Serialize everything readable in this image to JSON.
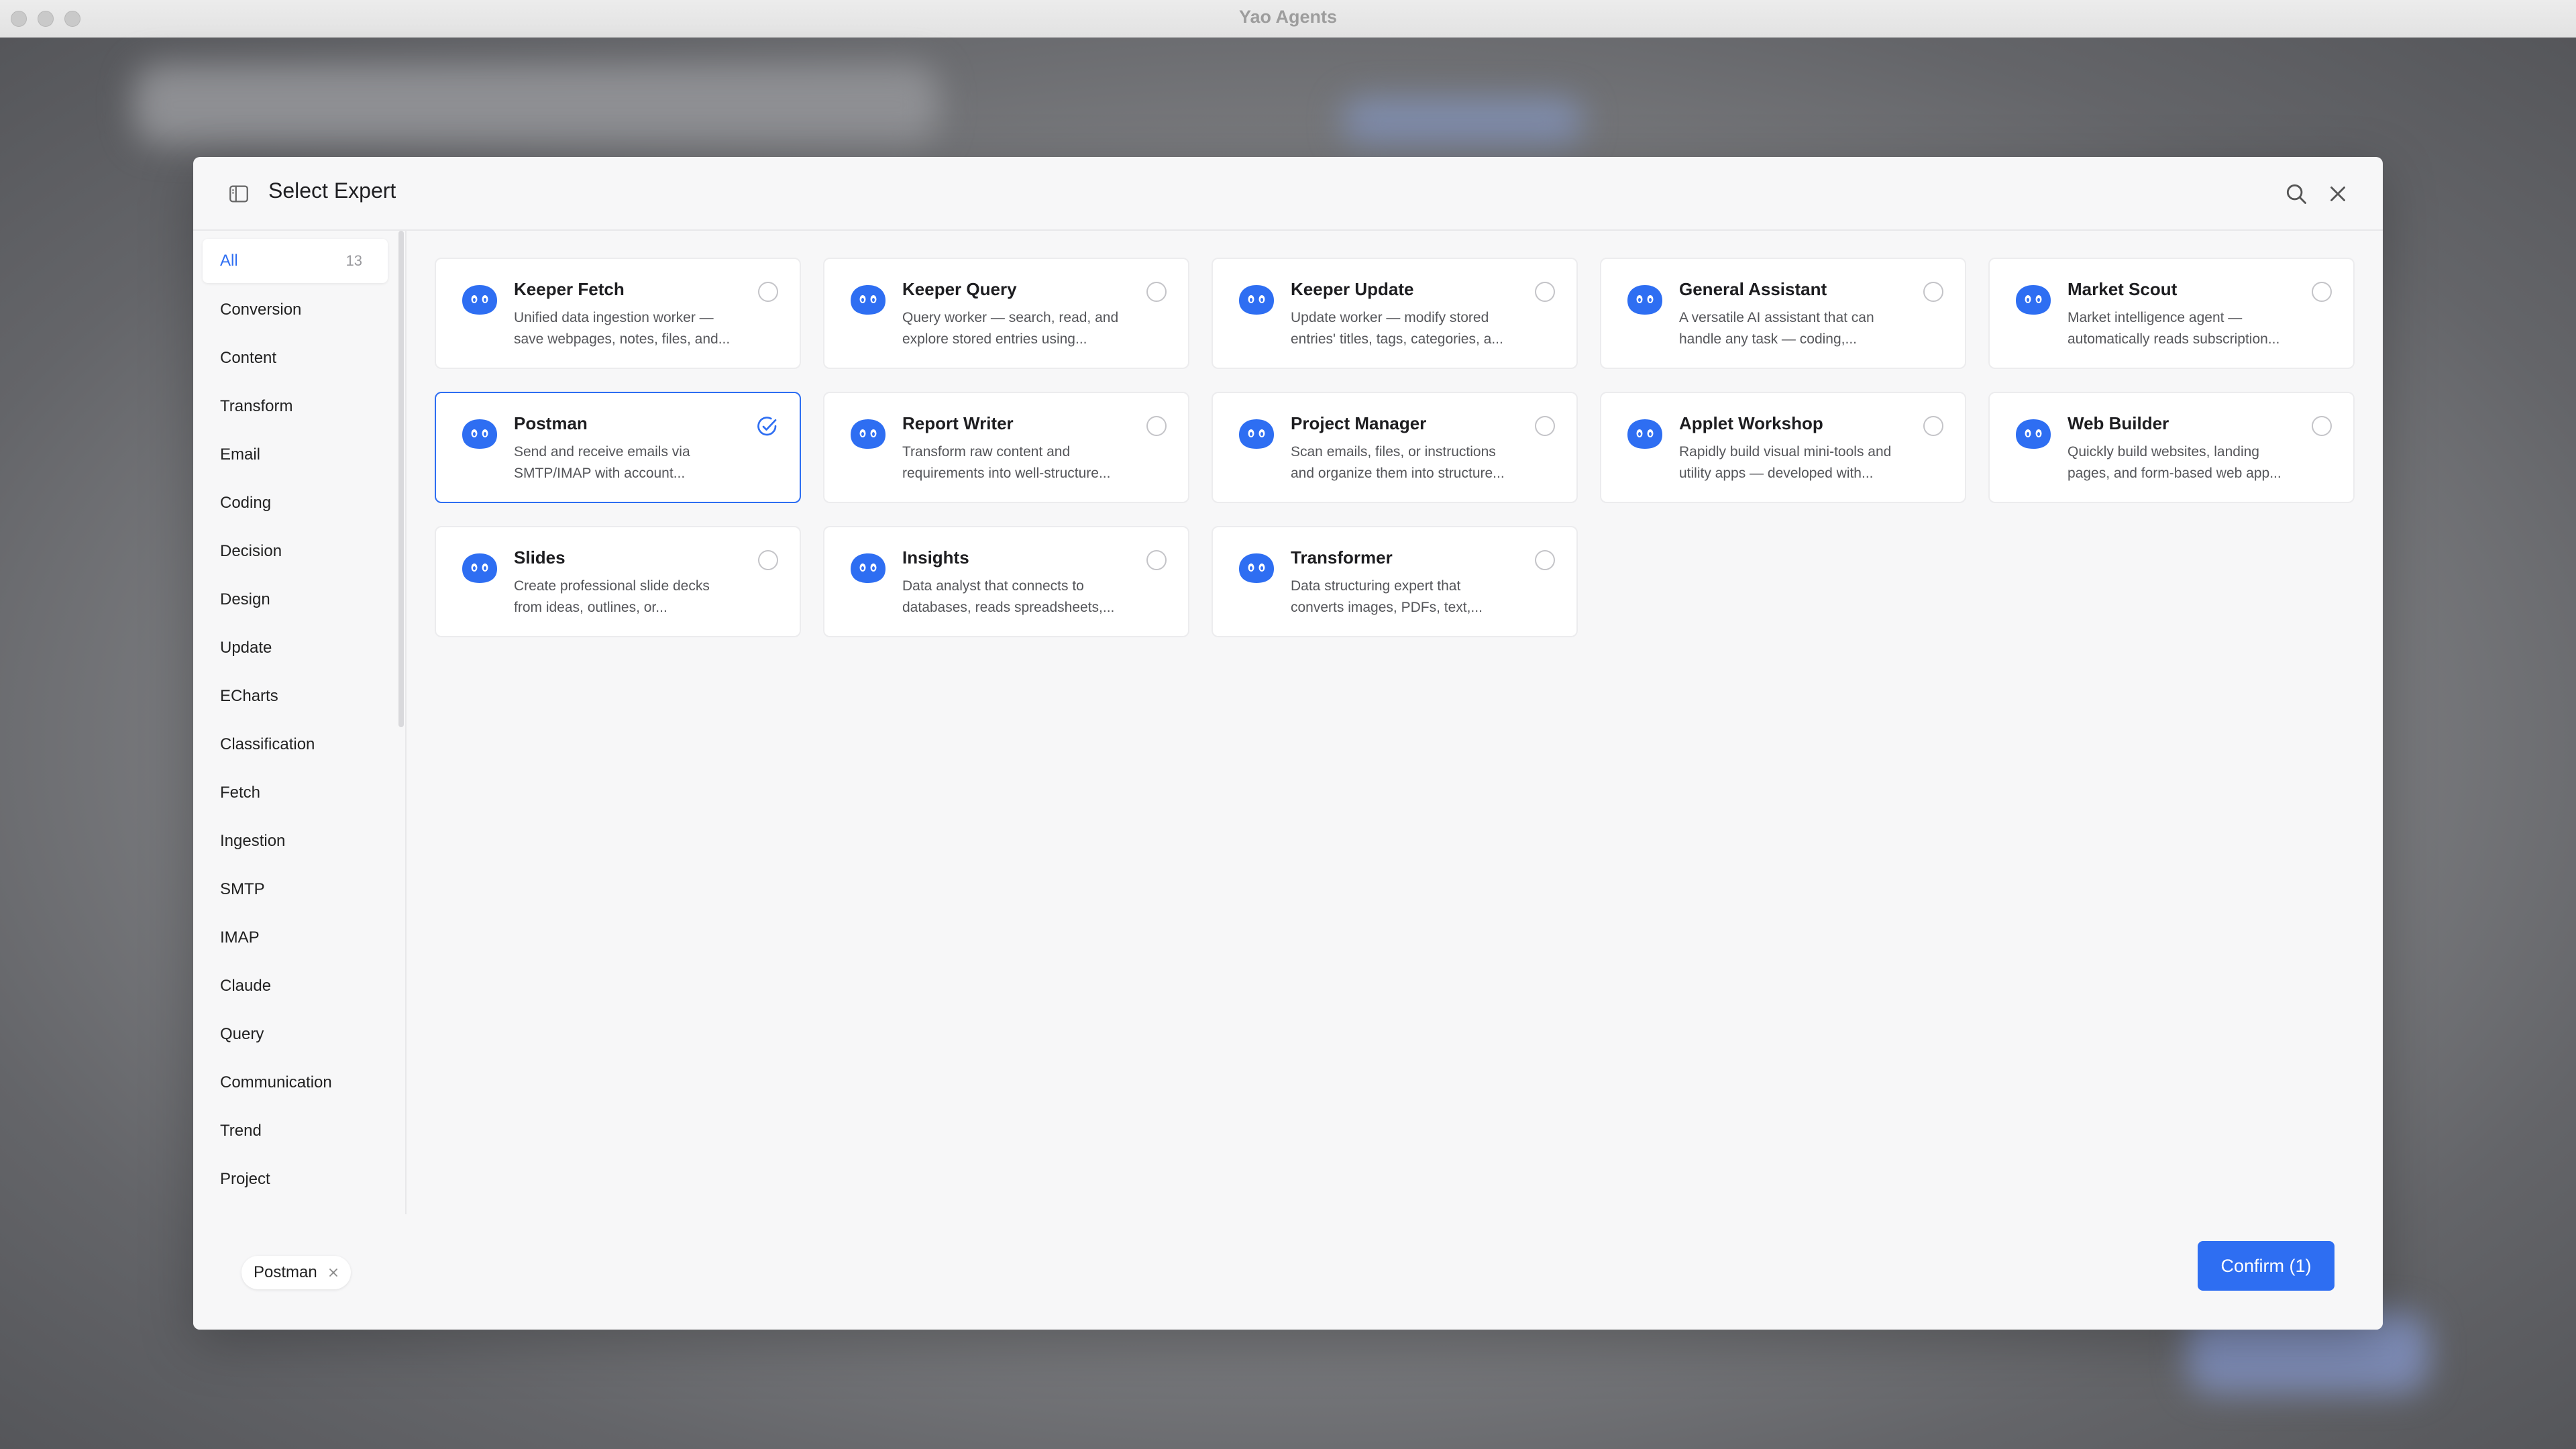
{
  "window": {
    "title": "Yao Agents"
  },
  "modal": {
    "title": "Select Expert",
    "icons": {
      "sidebar_toggle": "sidebar-panel-icon",
      "search": "search-icon",
      "close": "close-icon"
    }
  },
  "sidebar": {
    "items": [
      {
        "label": "All",
        "count": "13",
        "active": true
      },
      {
        "label": "Conversion"
      },
      {
        "label": "Content"
      },
      {
        "label": "Transform"
      },
      {
        "label": "Email"
      },
      {
        "label": "Coding"
      },
      {
        "label": "Decision"
      },
      {
        "label": "Design"
      },
      {
        "label": "Update"
      },
      {
        "label": "ECharts"
      },
      {
        "label": "Classification"
      },
      {
        "label": "Fetch"
      },
      {
        "label": "Ingestion"
      },
      {
        "label": "SMTP"
      },
      {
        "label": "IMAP"
      },
      {
        "label": "Claude"
      },
      {
        "label": "Query"
      },
      {
        "label": "Communication"
      },
      {
        "label": "Trend"
      },
      {
        "label": "Project"
      }
    ]
  },
  "experts": [
    {
      "name": "Keeper Fetch",
      "desc1": "Unified data ingestion worker —",
      "desc2": "save webpages, notes, files, and...",
      "selected": false
    },
    {
      "name": "Keeper Query",
      "desc1": "Query worker — search, read, and",
      "desc2": "explore stored entries using...",
      "selected": false
    },
    {
      "name": "Keeper Update",
      "desc1": "Update worker — modify stored",
      "desc2": "entries' titles, tags, categories, a...",
      "selected": false
    },
    {
      "name": "General Assistant",
      "desc1": "A versatile AI assistant that can",
      "desc2": "handle any task — coding,...",
      "selected": false
    },
    {
      "name": "Market Scout",
      "desc1": "Market intelligence agent —",
      "desc2": "automatically reads subscription...",
      "selected": false
    },
    {
      "name": "Postman",
      "desc1": "Send and receive emails via",
      "desc2": "SMTP/IMAP with account...",
      "selected": true
    },
    {
      "name": "Report Writer",
      "desc1": "Transform raw content and",
      "desc2": "requirements into well-structure...",
      "selected": false
    },
    {
      "name": "Project Manager",
      "desc1": "Scan emails, files, or instructions",
      "desc2": "and organize them into structure...",
      "selected": false
    },
    {
      "name": "Applet Workshop",
      "desc1": "Rapidly build visual mini-tools and",
      "desc2": "utility apps — developed with...",
      "selected": false
    },
    {
      "name": "Web Builder",
      "desc1": "Quickly build websites, landing",
      "desc2": "pages, and form-based web app...",
      "selected": false
    },
    {
      "name": "Slides",
      "desc1": "Create professional slide decks",
      "desc2": "from ideas, outlines, or...",
      "selected": false
    },
    {
      "name": "Insights",
      "desc1": "Data analyst that connects to",
      "desc2": "databases, reads spreadsheets,...",
      "selected": false
    },
    {
      "name": "Transformer",
      "desc1": "Data structuring expert that",
      "desc2": "converts images, PDFs, text,...",
      "selected": false
    }
  ],
  "footer": {
    "selected_chip": "Postman",
    "confirm_label": "Confirm (1)"
  },
  "colors": {
    "accent": "#2e6ef2",
    "avatar": "#2e6ef2"
  }
}
